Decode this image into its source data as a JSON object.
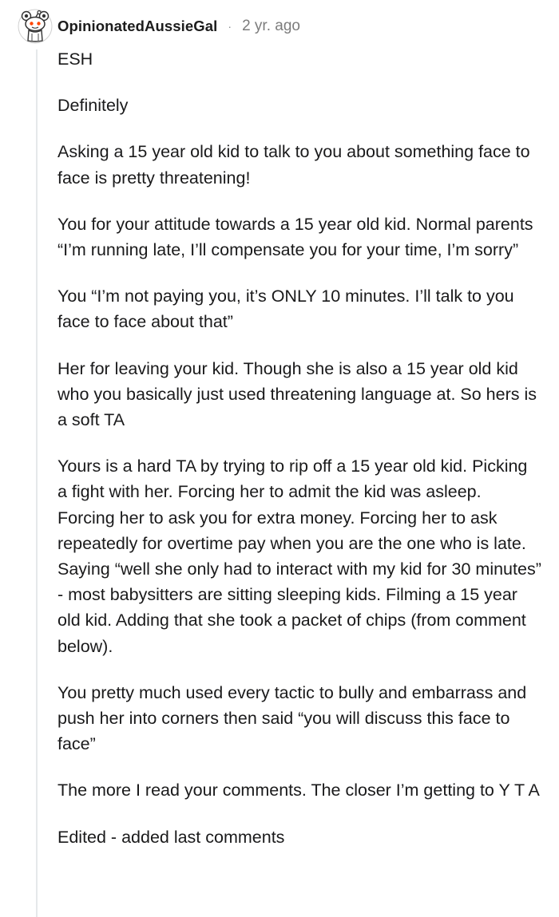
{
  "comment": {
    "username": "OpinionatedAussieGal",
    "separator": "·",
    "timestamp": "2 yr. ago",
    "avatar_icon": "snoo-avatar-icon",
    "thread_line_color": "#e5e8ea",
    "paragraphs": [
      "ESH",
      "Definitely",
      "Asking a 15 year old kid to talk to you about something face to face is pretty threatening!",
      "You for your attitude towards a 15 year old kid. Normal parents “I’m running late, I’ll compensate you for your time, I’m sorry”",
      "You “I’m not paying you, it’s ONLY 10 minutes. I’ll talk to you face to face about that”",
      "Her for leaving your kid. Though she is also a 15 year old kid who you basically just used threatening language at. So hers is a soft TA",
      "Yours is a hard TA by trying to rip off a 15 year old kid. Picking a fight with her. Forcing her to admit the kid was asleep. Forcing her to ask you for extra money. Forcing her to ask repeatedly for overtime pay when you are the one who is late. Saying “well she only had to interact with my kid for 30 minutes” - most babysitters are sitting sleeping kids. Filming a 15 year old kid. Adding that she took a packet of chips (from comment below).",
      "You pretty much used every tactic to bully and embarrass and push her into corners then said “you will discuss this face to face”",
      "The more I read your comments. The closer I’m getting to Y T A",
      "Edited - added last comments"
    ]
  }
}
